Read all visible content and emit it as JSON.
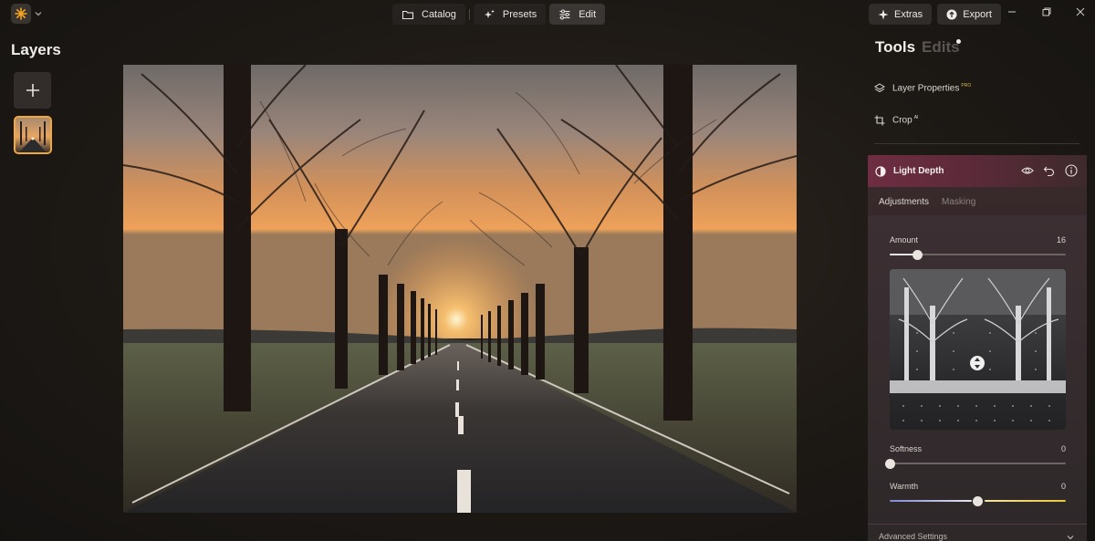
{
  "topbar": {
    "nav": [
      {
        "label": "Catalog",
        "icon": "folder-icon"
      },
      {
        "label": "Presets",
        "icon": "sparkle-icon"
      },
      {
        "label": "Edit",
        "icon": "sliders-icon",
        "active": true
      }
    ],
    "extras_label": "Extras",
    "export_label": "Export"
  },
  "layers": {
    "title": "Layers"
  },
  "tools_panel": {
    "tab_tools": "Tools",
    "tab_edits": "Edits",
    "layer_properties": {
      "label": "Layer Properties",
      "badge": "PRO"
    },
    "crop": {
      "label": "Crop",
      "badge": "AI"
    },
    "light_depth": {
      "title": "Light Depth",
      "subtabs": [
        "Adjustments",
        "Masking"
      ],
      "amount": {
        "label": "Amount",
        "value": "16",
        "fraction": 0.16
      },
      "softness": {
        "label": "Softness",
        "value": "0",
        "fraction": 0
      },
      "warmth": {
        "label": "Warmth",
        "value": "0",
        "fraction": 0.5
      }
    },
    "advanced_label": "Advanced Settings"
  },
  "colors": {
    "accent": "#f0a93a",
    "section_header": "#6e2d42",
    "pro_badge": "#d4b84a"
  }
}
